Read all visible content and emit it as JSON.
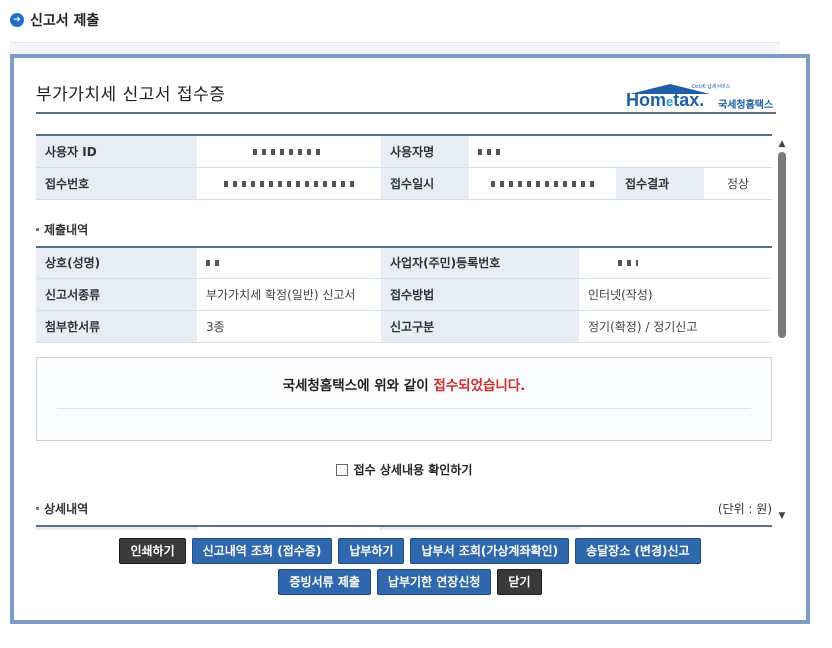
{
  "page": {
    "header_title": "신고서 제출",
    "header_icon": "arrow-right-circle-icon"
  },
  "receipt": {
    "title": "부가가치세 신고서 접수증"
  },
  "logo": {
    "small": "Oct/K 납세서비스",
    "brand_main": "Hom",
    "brand_e": "e",
    "brand_tail": "tax.",
    "brand_ko": "국세청홈택스"
  },
  "user_table": {
    "user_id_label": "사용자 ID",
    "user_id_value": "",
    "user_name_label": "사용자명",
    "user_name_value": "",
    "receipt_no_label": "접수번호",
    "receipt_no_value": "",
    "receipt_date_label": "접수일시",
    "receipt_date_value": "",
    "receipt_result_label": "접수결과",
    "receipt_result_value": "정상"
  },
  "submission": {
    "section_title": "제출내역",
    "company_label": "상호(성명)",
    "company_value": "",
    "reg_no_label": "사업자(주민)등록번호",
    "reg_no_value": "",
    "form_type_label": "신고서종류",
    "form_type_value": "부가가치세 확정(일반) 신고서",
    "method_label": "접수방법",
    "method_value": "인터넷(작성)",
    "attachments_label": "첨부한서류",
    "attachments_value": "3종",
    "category_label": "신고구분",
    "category_value": "정기(확정) / 정기신고"
  },
  "notice": {
    "text_before": "국세청홈택스에 위와 같이 ",
    "text_red": "접수되었습니다."
  },
  "confirm": {
    "label": "접수 상세내용 확인하기"
  },
  "details": {
    "section_title": "상세내역",
    "unit": "(단위 : 원)"
  },
  "buttons": {
    "print": "인쇄하기",
    "view_receipt": "신고내역 조회 (접수증)",
    "pay": "납부하기",
    "view_bill": "납부서 조회(가상계좌확인)",
    "delivery": "송달장소 (변경)신고",
    "submit_proof": "증빙서류 제출",
    "extend": "납부기한 연장신청",
    "close": "닫기"
  },
  "colors": {
    "accent": "#2f68ad",
    "frame": "#7e9dc6",
    "success_red": "#d12b2b"
  }
}
